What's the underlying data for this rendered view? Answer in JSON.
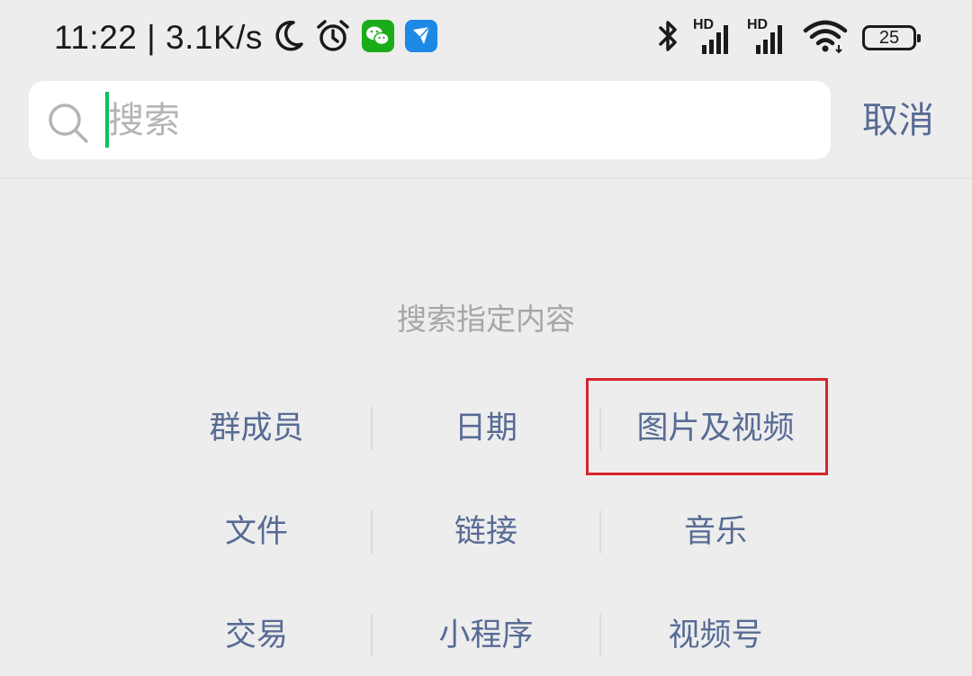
{
  "status_bar": {
    "time_speed": "11:22 | 3.1K/s",
    "signal_1_label": "HD",
    "signal_2_label": "HD",
    "battery_level": "25",
    "icons": [
      "moon-icon",
      "alarm-icon",
      "wechat-icon",
      "feishu-icon",
      "bluetooth-icon",
      "signal-icon",
      "wifi-icon",
      "battery-icon"
    ],
    "colors": {
      "wechat": "#1aad19",
      "feishu": "#1e88e5"
    }
  },
  "search": {
    "placeholder": "搜索",
    "value": "",
    "cancel_label": "取消",
    "caret_color": "#07c160"
  },
  "section": {
    "title": "搜索指定内容"
  },
  "categories": [
    "群成员",
    "日期",
    "图片及视频",
    "文件",
    "链接",
    "音乐",
    "交易",
    "小程序",
    "视频号"
  ],
  "colors": {
    "link": "#576b95",
    "highlight_border": "#d5252d",
    "background": "#ededed"
  }
}
